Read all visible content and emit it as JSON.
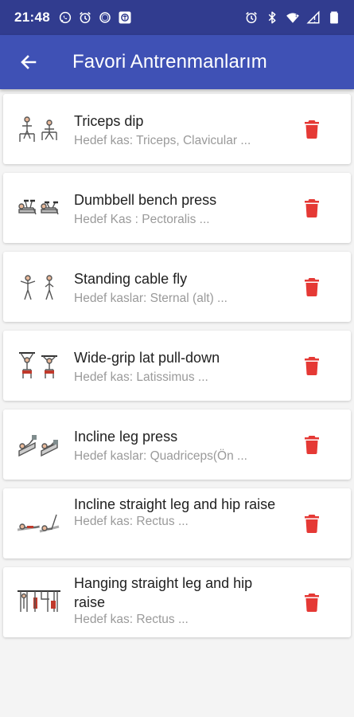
{
  "status_bar": {
    "time": "21:48",
    "left_icons": [
      "whatsapp-icon",
      "alarm-icon",
      "circle-icon",
      "app-badge-icon"
    ],
    "right_icons": [
      "alarm-icon",
      "bluetooth-icon",
      "wifi-icon",
      "signal-icon",
      "battery-icon"
    ]
  },
  "app_bar": {
    "title": "Favori Antrenmanlarım",
    "back_icon": "arrow-back-icon",
    "color": "#3f51b5",
    "status_color": "#313c8f"
  },
  "accent": {
    "delete_color": "#e53935"
  },
  "exercises": [
    {
      "title": "Triceps dip",
      "target": "Hedef kas: Triceps, Clavicular ..."
    },
    {
      "title": "Dumbbell bench press",
      "target": "Hedef Kas : Pectoralis ..."
    },
    {
      "title": "Standing cable fly",
      "target": "Hedef kaslar: Sternal (alt) ..."
    },
    {
      "title": "Wide-grip lat pull-down",
      "target": "Hedef kas: Latissimus ..."
    },
    {
      "title": "Incline leg press",
      "target": "Hedef kaslar: Quadriceps(Ön ..."
    },
    {
      "title": "Incline straight leg and hip raise",
      "target": "Hedef kas: Rectus ..."
    },
    {
      "title": "Hanging straight leg and hip raise",
      "target": "Hedef kas: Rectus ..."
    }
  ]
}
